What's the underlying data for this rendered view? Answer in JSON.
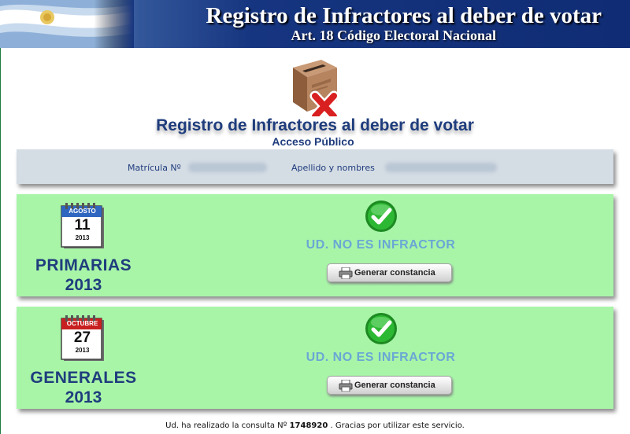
{
  "header": {
    "title": "Registro de Infractores al deber de votar",
    "subtitle": "Art. 18 Código Electoral Nacional"
  },
  "main": {
    "title": "Registro de Infractores al deber de votar",
    "subtitle": "Acceso Público"
  },
  "info": {
    "matricula_label": "Matrícula Nº",
    "nombre_label": "Apellido y nombres"
  },
  "elections": [
    {
      "calendar_month": "AGOSTO",
      "calendar_day": "11",
      "calendar_year": "2013",
      "name": "PRIMARIAS",
      "year": "2013",
      "status": "UD. NO ES INFRACTOR",
      "button_label": "Generar constancia"
    },
    {
      "calendar_month": "OCTUBRE",
      "calendar_day": "27",
      "calendar_year": "2013",
      "name": "GENERALES",
      "year": "2013",
      "status": "UD. NO ES INFRACTOR",
      "button_label": "Generar constancia"
    }
  ],
  "footer": {
    "before": "Ud. ha realizado la consulta Nº",
    "number": "1748920",
    "after": ". Gracias por utilizar este servicio."
  },
  "colors": {
    "header_blue": "#0f2c74",
    "title_blue": "#1f3d7d",
    "panel_green": "#a8f5a8",
    "status_blue": "#6aa7d4",
    "month_agosto": "#2f66c0",
    "month_octubre": "#c82020",
    "check_green": "#22a028"
  },
  "icons": {
    "flag": "argentina-flag-icon",
    "ballot": "ballot-box-x-icon",
    "calendar": "calendar-icon",
    "check": "checkmark-icon",
    "printer": "printer-icon"
  }
}
